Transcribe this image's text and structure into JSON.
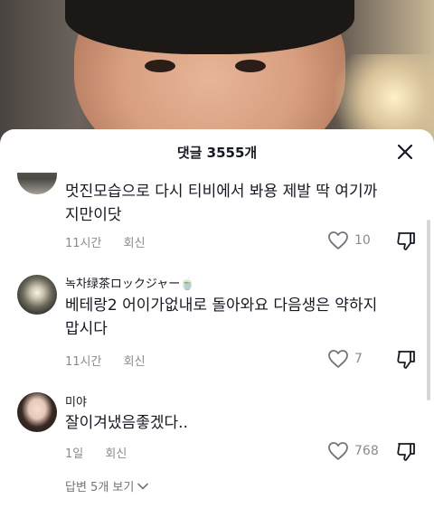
{
  "header": {
    "title": "댓글 3555개"
  },
  "comments": [
    {
      "author": "",
      "text_line1": "멋진모습으로 다시 티비에서 봐용 제발 딱 여기까",
      "text_line2": "지만이닷",
      "time": "11시간",
      "reply": "회신",
      "likes": "10"
    },
    {
      "author": "녹차绿茶ロックジャー🍵",
      "text_line1": "베테랑2 어이가없내로 돌아와요 다음생은 약하지",
      "text_line2": "맙시다",
      "time": "11시간",
      "reply": "회신",
      "likes": "7"
    },
    {
      "author": "미야",
      "text_line1": "잘이겨냈음좋겠다..",
      "time": "1일",
      "reply": "회신",
      "likes": "768",
      "more_replies": "답변 5개 보기"
    }
  ],
  "colors": {
    "text": "#161823",
    "muted": "#8a8b91",
    "background": "#ffffff"
  },
  "icons": [
    "close-icon",
    "heart-icon",
    "dislike-icon",
    "chevron-down-icon"
  ]
}
